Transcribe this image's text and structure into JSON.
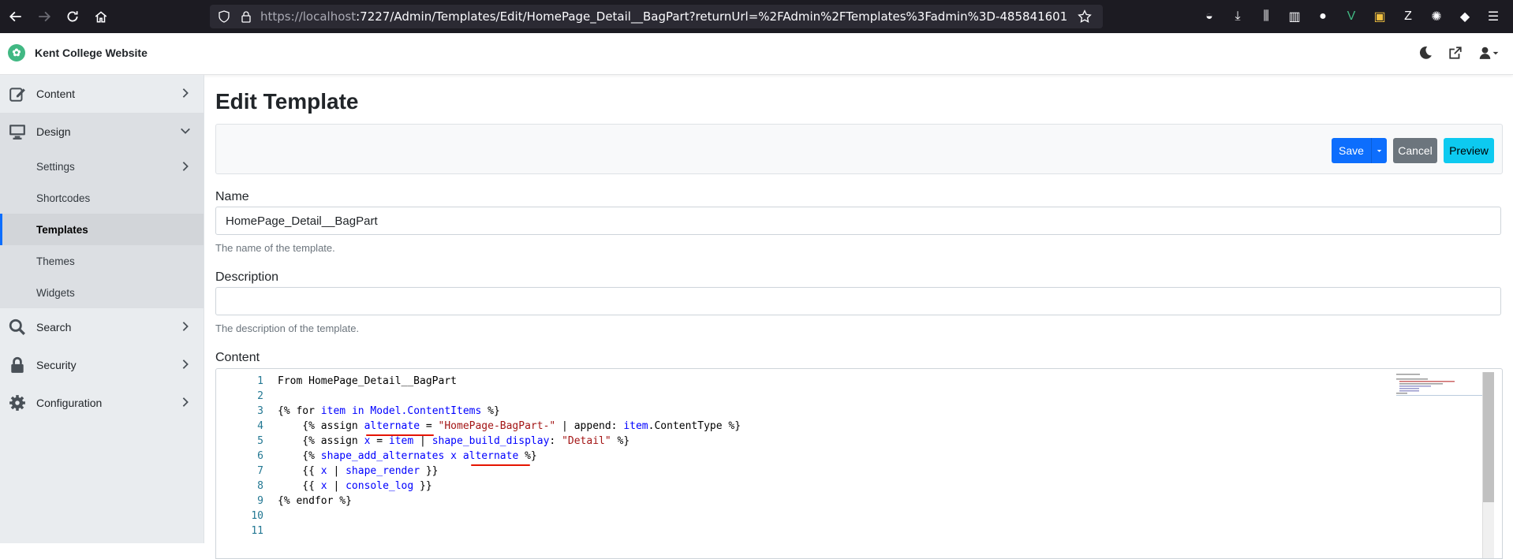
{
  "browser": {
    "url_host": "https://localhost",
    "url_rest": ":7227/Admin/Templates/Edit/HomePage_Detail__BagPart?returnUrl=%2FAdmin%2FTemplates%3Fadmin%3D-485841601"
  },
  "header": {
    "brand": "Kent College Website"
  },
  "sidebar": {
    "items": [
      {
        "label": "Content"
      },
      {
        "label": "Design"
      },
      {
        "label": "Search"
      },
      {
        "label": "Security"
      },
      {
        "label": "Configuration"
      }
    ],
    "design_sub": [
      {
        "label": "Settings"
      },
      {
        "label": "Shortcodes"
      },
      {
        "label": "Templates"
      },
      {
        "label": "Themes"
      },
      {
        "label": "Widgets"
      }
    ]
  },
  "main": {
    "title": "Edit Template",
    "buttons": {
      "save": "Save",
      "cancel": "Cancel",
      "preview": "Preview"
    },
    "name_label": "Name",
    "name_value": "HomePage_Detail__BagPart",
    "name_help": "The name of the template.",
    "description_label": "Description",
    "description_value": "",
    "description_help": "The description of the template.",
    "content_label": "Content"
  },
  "editor": {
    "line_numbers": [
      "1",
      "2",
      "3",
      "4",
      "5",
      "6",
      "7",
      "8",
      "9",
      "10",
      "11"
    ],
    "lines": [
      "From HomePage_Detail__BagPart",
      "",
      "{% for item in Model.ContentItems %}",
      "    {% assign alternate = \"HomePage-BagPart-\" | append: item.ContentType %}",
      "    {% assign x = item | shape_build_display: \"Detail\" %}",
      "    {% shape_add_alternates x alternate %}",
      "    {{ x | shape_render }}",
      "    {{ x | console_log }}",
      "{% endfor %}",
      "",
      ""
    ]
  }
}
